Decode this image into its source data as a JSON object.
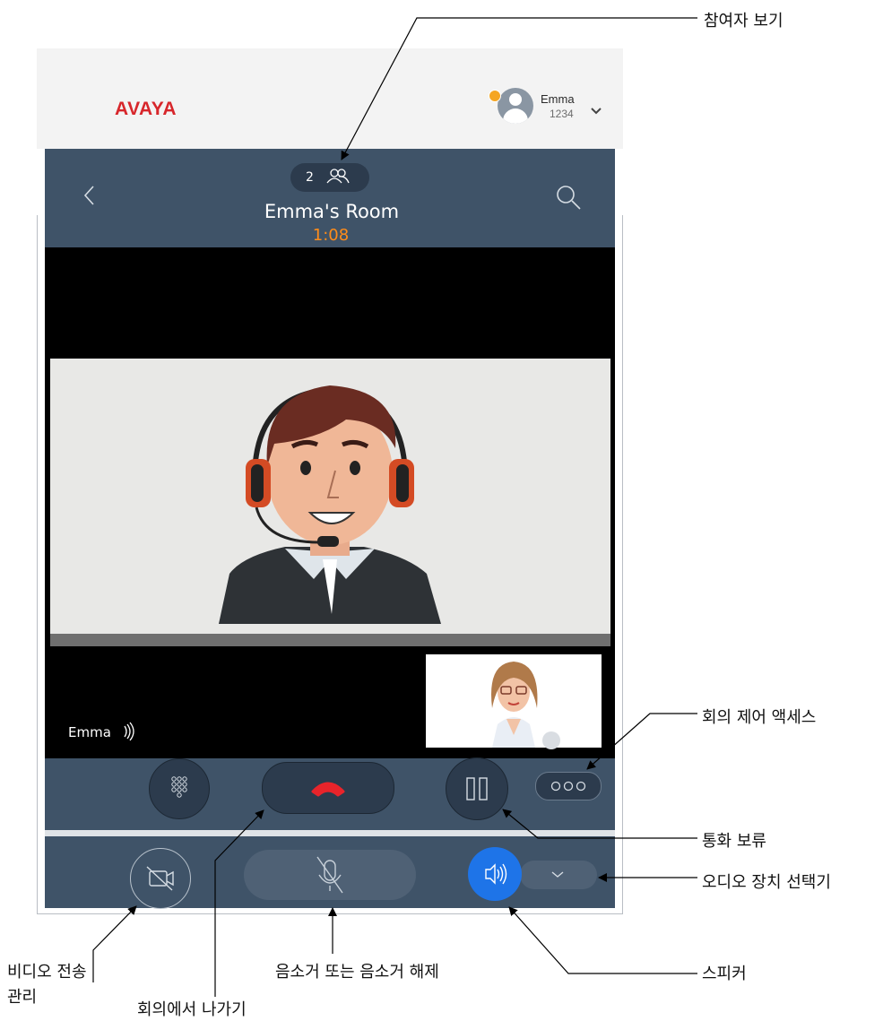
{
  "header": {
    "brand": "AVAYA",
    "user": {
      "name": "Emma",
      "extension": "1234"
    }
  },
  "call": {
    "participant_count": "2",
    "room_name": "Emma's Room",
    "timer": "1:08",
    "self_name": "Emma"
  },
  "icons": {
    "back": "chevron-left-icon",
    "search": "search-icon",
    "participants": "people-icon",
    "dialpad": "dialpad-icon",
    "end_call": "phone-hangup-icon",
    "hold": "pause-icon",
    "more": "more-icon",
    "video": "video-off-icon",
    "mute": "mic-off-icon",
    "speaker": "speaker-icon",
    "audio_select": "chevron-down-icon"
  },
  "colors": {
    "header_bg": "#3f5368",
    "timer": "#ff8c1a",
    "end_call": "#e8242b",
    "speaker_active": "#1e74e8",
    "brand": "#d7262b"
  },
  "callouts": {
    "participants": "참여자 보기",
    "conference_controls": "회의 제어 액세스",
    "hold": "통화 보류",
    "audio_device": "오디오 장치 선택기",
    "speaker": "스피커",
    "mute": "음소거 또는 음소거 해제",
    "leave": "회의에서 나가기",
    "video_line1": "비디오 전송",
    "video_line2": "관리"
  }
}
